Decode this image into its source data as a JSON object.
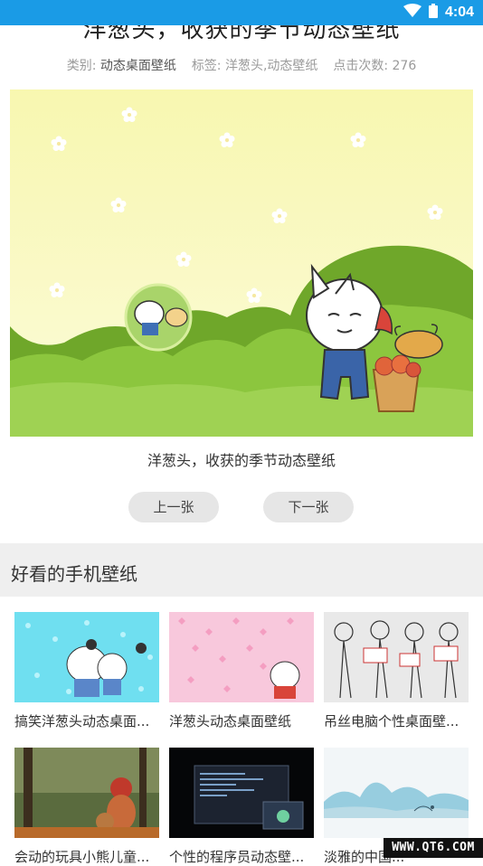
{
  "status_bar": {
    "time": "4:04"
  },
  "article": {
    "title": "洋葱头，收获的季节动态壁纸",
    "category_label": "类别:",
    "category_value": "动态桌面壁纸",
    "tags_label": "标签:",
    "tags_value": "洋葱头,动态壁纸",
    "clicks_label": "点击次数:",
    "clicks_value": "276",
    "caption": "洋葱头，收获的季节动态壁纸"
  },
  "nav": {
    "prev_label": "上一张",
    "next_label": "下一张"
  },
  "section": {
    "title": "好看的手机壁纸"
  },
  "wallpapers": [
    {
      "title": "搞笑洋葱头动态桌面..."
    },
    {
      "title": "洋葱头动态桌面壁纸"
    },
    {
      "title": "吊丝电脑个性桌面壁..."
    },
    {
      "title": "会动的玩具小熊儿童..."
    },
    {
      "title": "个性的程序员动态壁..."
    },
    {
      "title": "淡雅的中国..."
    }
  ],
  "watermark": "WWW.QT6.COM"
}
